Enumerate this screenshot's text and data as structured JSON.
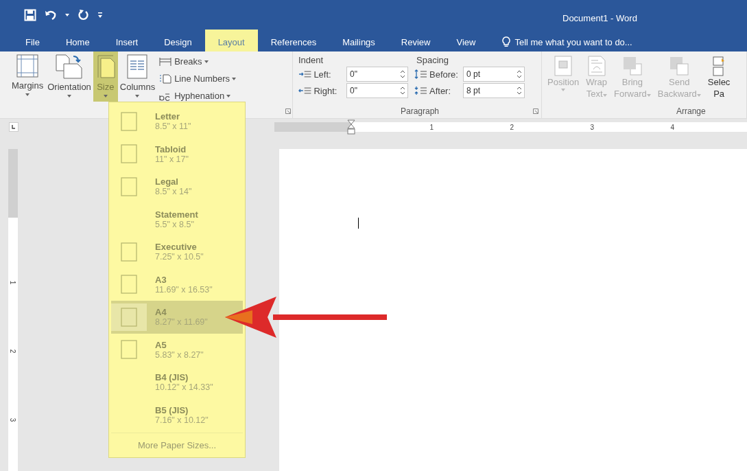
{
  "title_bar": {
    "title": "Document1 - Word"
  },
  "tabs": [
    {
      "label": "File",
      "selected": false
    },
    {
      "label": "Home",
      "selected": false
    },
    {
      "label": "Insert",
      "selected": false
    },
    {
      "label": "Design",
      "selected": false
    },
    {
      "label": "Layout",
      "selected": true
    },
    {
      "label": "References",
      "selected": false
    },
    {
      "label": "Mailings",
      "selected": false
    },
    {
      "label": "Review",
      "selected": false
    },
    {
      "label": "View",
      "selected": false
    }
  ],
  "tell_me": {
    "placeholder": "Tell me what you want to do..."
  },
  "page_setup": {
    "buttons": [
      {
        "label": "Margins",
        "kind": "margins",
        "selected": false
      },
      {
        "label": "Orientation",
        "kind": "orientation",
        "selected": false
      },
      {
        "label": "Size",
        "kind": "size",
        "selected": true
      },
      {
        "label": "Columns",
        "kind": "columns",
        "selected": false
      }
    ],
    "commands": [
      {
        "label": "Breaks",
        "kind": "breaks"
      },
      {
        "label": "Line Numbers",
        "kind": "line-numbers"
      },
      {
        "label": "Hyphenation",
        "kind": "hyphenation"
      }
    ]
  },
  "paragraph": {
    "label": "Paragraph",
    "indent_heading": "Indent",
    "spacing_heading": "Spacing",
    "indent": [
      {
        "label": "Left:",
        "value": "0\""
      },
      {
        "label": "Right:",
        "value": "0\""
      }
    ],
    "spacing": [
      {
        "label": "Before:",
        "value": "0 pt"
      },
      {
        "label": "After:",
        "value": "8 pt"
      }
    ]
  },
  "arrange": {
    "label": "Arrange",
    "buttons": [
      {
        "lines": [
          "Position"
        ],
        "dropdown": true,
        "disabled": true,
        "kind": "position"
      },
      {
        "lines": [
          "Wrap",
          "Text"
        ],
        "dropdown": true,
        "disabled": true,
        "kind": "wrap"
      },
      {
        "lines": [
          "Bring",
          "Forward"
        ],
        "dropdown": true,
        "disabled": true,
        "kind": "bring"
      },
      {
        "lines": [
          "Send",
          "Backward"
        ],
        "dropdown": true,
        "disabled": true,
        "kind": "send"
      },
      {
        "lines": [
          "Selec",
          "Pa"
        ],
        "dropdown": false,
        "disabled": false,
        "kind": "select"
      }
    ]
  },
  "ruler": {
    "marks": [
      "1",
      "2",
      "3",
      "4"
    ]
  },
  "vertical_ruler": {
    "marks": [
      "1",
      "2",
      "3"
    ]
  },
  "size_menu": {
    "items": [
      {
        "name": "Letter",
        "dimensions": "8.5\" x 11\"",
        "kind": "icon",
        "selected": false
      },
      {
        "name": "Tabloid",
        "dimensions": "11\" x 17\"",
        "kind": "icon",
        "selected": false
      },
      {
        "name": "Legal",
        "dimensions": "8.5\" x 14\"",
        "kind": "icon",
        "selected": false
      },
      {
        "name": "Statement",
        "dimensions": "5.5\" x 8.5\"",
        "kind": "plain",
        "selected": false
      },
      {
        "name": "Executive",
        "dimensions": "7.25\" x 10.5\"",
        "kind": "icon",
        "selected": false
      },
      {
        "name": "A3",
        "dimensions": "11.69\" x 16.53\"",
        "kind": "icon",
        "selected": false
      },
      {
        "name": "A4",
        "dimensions": "8.27\" x 11.69\"",
        "kind": "icon",
        "selected": true
      },
      {
        "name": "A5",
        "dimensions": "5.83\" x 8.27\"",
        "kind": "icon",
        "selected": false
      },
      {
        "name": "B4 (JIS)",
        "dimensions": "10.12\" x 14.33\"",
        "kind": "plain",
        "selected": false
      },
      {
        "name": "B5 (JIS)",
        "dimensions": "7.16\" x 10.12\"",
        "kind": "plain",
        "selected": false
      }
    ],
    "footer": "More Paper Sizes..."
  }
}
